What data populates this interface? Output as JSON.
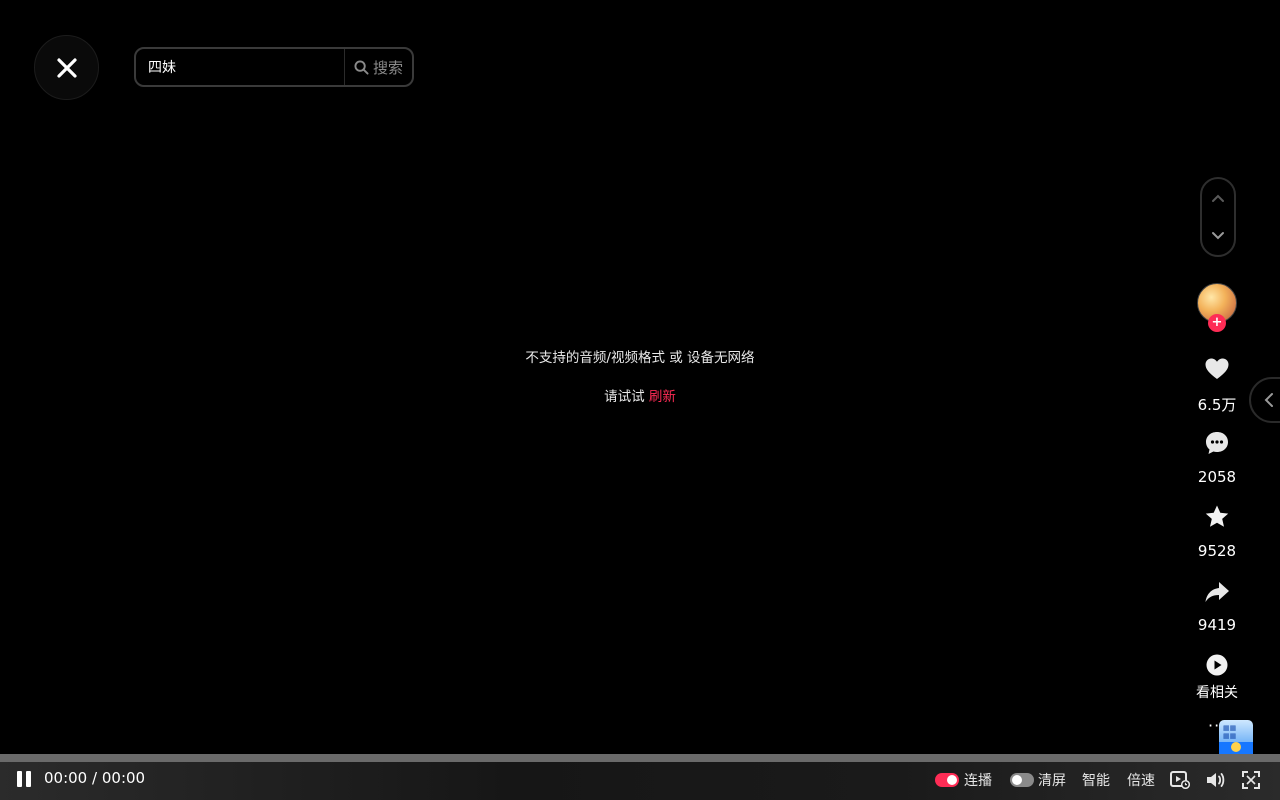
{
  "search": {
    "value": "四妹",
    "button_label": "搜索"
  },
  "player": {
    "error_message": "不支持的音频/视频格式 或 设备无网络",
    "retry_prefix": "请试试",
    "refresh_label": "刷新",
    "progress_fraction": 0,
    "current_time": "00:00",
    "separator": "/",
    "duration": "00:00"
  },
  "side_actions": {
    "follow_badge": "+",
    "like_count": "6.5万",
    "comment_count": "2058",
    "favorite_count": "9528",
    "share_count": "9419",
    "related_label": "看相关",
    "more_label": "···"
  },
  "controls": {
    "autoplay_label": "连播",
    "autoplay_on": true,
    "clear_screen_label": "清屏",
    "clear_screen_on": false,
    "smart_label": "智能",
    "speed_label": "倍速"
  },
  "colors": {
    "accent": "#fe2c55",
    "background": "#000000"
  },
  "icons": [
    "close-icon",
    "search-icon",
    "chevron-up-icon",
    "chevron-down-icon",
    "heart-icon",
    "comment-icon",
    "star-icon",
    "share-icon",
    "play-circle-icon",
    "chevron-left-icon",
    "pause-icon",
    "pip-icon",
    "volume-icon",
    "fullscreen-icon"
  ]
}
